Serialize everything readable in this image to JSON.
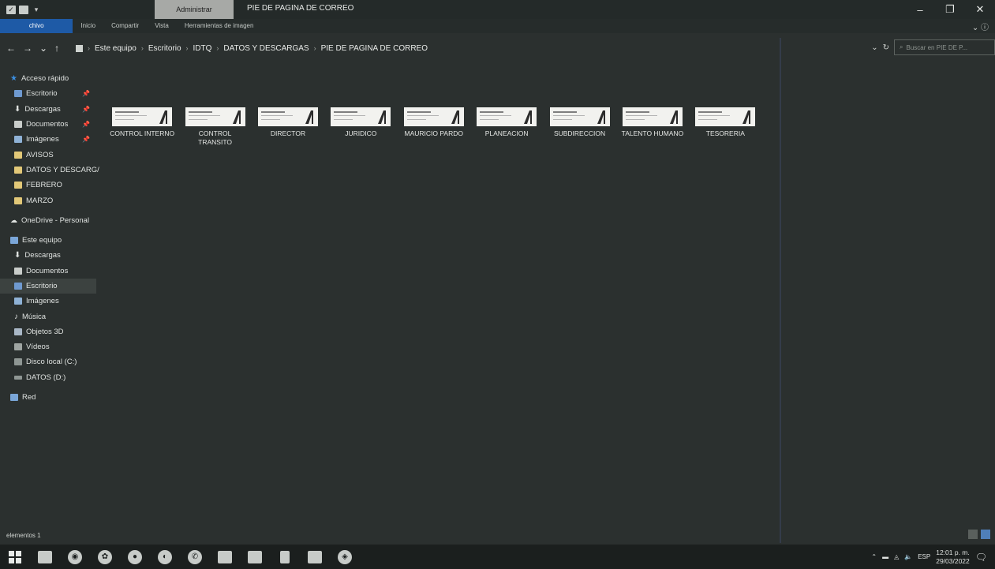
{
  "window": {
    "title": "PIE DE PAGINA DE CORREO",
    "context_tab": "Administrar"
  },
  "ribbon": {
    "tabs": [
      "chivo",
      "Inicio",
      "Compartir",
      "Vista",
      "Herramientas de imagen"
    ]
  },
  "address": {
    "crumbs": [
      "Este equipo",
      "Escritorio",
      "IDTQ",
      "DATOS Y DESCARGAS",
      "PIE DE PAGINA DE CORREO"
    ],
    "search_placeholder": "Buscar en PIE DE P..."
  },
  "nav": {
    "quick_access": "Acceso rápido",
    "quick_items": [
      "Escritorio",
      "Descargas",
      "Documentos",
      "Imágenes",
      "AVISOS",
      "DATOS Y DESCARG/",
      "FEBRERO",
      "MARZO"
    ],
    "onedrive": "OneDrive - Personal",
    "this_pc": "Este equipo",
    "pc_items": [
      "Descargas",
      "Documentos",
      "Escritorio",
      "Imágenes",
      "Música",
      "Objetos 3D",
      "Vídeos",
      "Disco local (C:)",
      "DATOS (D:)"
    ],
    "network": "Red"
  },
  "files": [
    {
      "name": "CONTROL INTERNO"
    },
    {
      "name": "CONTROL TRANSITO"
    },
    {
      "name": "DIRECTOR"
    },
    {
      "name": "JURIDICO"
    },
    {
      "name": "MAURICIO PARDO"
    },
    {
      "name": "PLANEACION"
    },
    {
      "name": "SUBDIRECCION"
    },
    {
      "name": "TALENTO HUMANO"
    },
    {
      "name": "TESORERIA"
    }
  ],
  "status": {
    "item_count": "elementos 1"
  },
  "taskbar": {
    "language": "ESP",
    "time": "12:01 p. m.",
    "date": "29/03/2022"
  },
  "colors": {
    "background": "#2b302f",
    "file_tab": "#1e5aa6"
  }
}
